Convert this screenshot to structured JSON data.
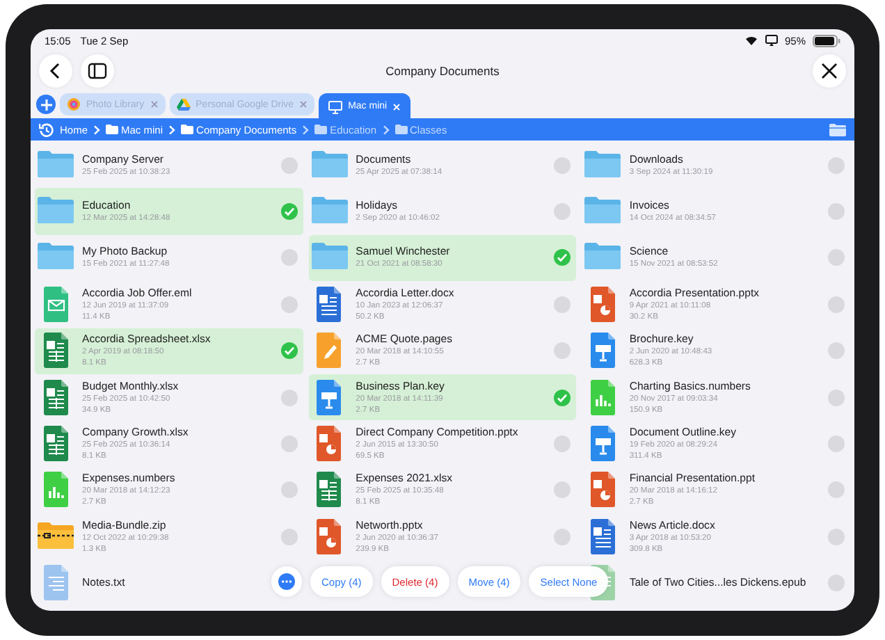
{
  "status_bar": {
    "time": "15:05",
    "date": "Tue 2 Sep",
    "battery": "95%"
  },
  "title": "Company Documents",
  "tabs": [
    {
      "label": "Photo Library",
      "kind": "photos",
      "selected": false
    },
    {
      "label": "Personal Google Drive",
      "kind": "drive",
      "selected": false
    },
    {
      "label": "Mac mini",
      "kind": "computer",
      "selected": true
    }
  ],
  "breadcrumb": [
    {
      "label": "Home",
      "folder": false,
      "disabled": false
    },
    {
      "label": "Mac mini",
      "folder": true,
      "disabled": false
    },
    {
      "label": "Company Documents",
      "folder": true,
      "disabled": false
    },
    {
      "label": "Education",
      "folder": true,
      "disabled": true
    },
    {
      "label": "Classes",
      "folder": true,
      "disabled": true
    }
  ],
  "files": [
    {
      "name": "Company Server",
      "date": "25 Feb 2025 at 10:38:23",
      "kind": "folder",
      "selected": false
    },
    {
      "name": "Documents",
      "date": "25 Apr 2025 at 07:38:14",
      "kind": "folder",
      "selected": false
    },
    {
      "name": "Downloads",
      "date": "3 Sep 2024 at 11:30:19",
      "kind": "folder",
      "selected": false
    },
    {
      "name": "Education",
      "date": "12 Mar 2025 at 14:28:48",
      "kind": "folder",
      "selected": true
    },
    {
      "name": "Holidays",
      "date": "2 Sep 2020 at 10:46:02",
      "kind": "folder",
      "selected": false
    },
    {
      "name": "Invoices",
      "date": "14 Oct 2024 at 08:34:57",
      "kind": "folder",
      "selected": false
    },
    {
      "name": "My Photo Backup",
      "date": "15 Feb 2021 at 11:27:48",
      "kind": "folder",
      "selected": false
    },
    {
      "name": "Samuel Winchester",
      "date": "21 Oct 2021 at 08:58:30",
      "kind": "folder",
      "selected": true
    },
    {
      "name": "Science",
      "date": "15 Nov 2021 at 08:53:52",
      "kind": "folder",
      "selected": false
    },
    {
      "name": "Accordia Job Offer.eml",
      "date": "12 Jun 2019 at 11:37:09",
      "size": "11.4 KB",
      "kind": "mail",
      "selected": false
    },
    {
      "name": "Accordia Letter.docx",
      "date": "10 Jan 2023 at 12:06:37",
      "size": "50.2 KB",
      "kind": "word",
      "selected": false
    },
    {
      "name": "Accordia Presentation.pptx",
      "date": "9 Apr 2021 at 10:11:08",
      "size": "30.2 KB",
      "kind": "powerpoint",
      "selected": false
    },
    {
      "name": "Accordia Spreadsheet.xlsx",
      "date": "2 Apr 2019 at 08:18:50",
      "size": "8.1 KB",
      "kind": "excel",
      "selected": true
    },
    {
      "name": "ACME Quote.pages",
      "date": "20 Mar 2018 at 14:10:55",
      "size": "2.7 KB",
      "kind": "pages",
      "selected": false
    },
    {
      "name": "Brochure.key",
      "date": "2 Jun 2020 at 10:48:43",
      "size": "628.3 KB",
      "kind": "keynote",
      "selected": false
    },
    {
      "name": "Budget Monthly.xlsx",
      "date": "25 Feb 2025 at 10:42:50",
      "size": "34.9 KB",
      "kind": "excel",
      "selected": false
    },
    {
      "name": "Business Plan.key",
      "date": "20 Mar 2018 at 14:11:39",
      "size": "2.7 KB",
      "kind": "keynote",
      "selected": true
    },
    {
      "name": "Charting Basics.numbers",
      "date": "20 Nov 2017 at 09:03:34",
      "size": "150.9 KB",
      "kind": "numbers",
      "selected": false
    },
    {
      "name": "Company Growth.xlsx",
      "date": "25 Feb 2025 at 10:36:14",
      "size": "8.1 KB",
      "kind": "excel",
      "selected": false
    },
    {
      "name": "Direct Company Competition.pptx",
      "date": "2 Jun 2015 at 13:30:50",
      "size": "69.5 KB",
      "kind": "powerpoint",
      "selected": false
    },
    {
      "name": "Document Outline.key",
      "date": "19 Feb 2020 at 08:29:24",
      "size": "311.4 KB",
      "kind": "keynote",
      "selected": false
    },
    {
      "name": "Expenses.numbers",
      "date": "20 Mar 2018 at 14:12:23",
      "size": "2.7 KB",
      "kind": "numbers",
      "selected": false
    },
    {
      "name": "Expenses 2021.xlsx",
      "date": "25 Feb 2025 at 10:35:48",
      "size": "8.1 KB",
      "kind": "excel",
      "selected": false
    },
    {
      "name": "Financial Presentation.ppt",
      "date": "20 Mar 2018 at 14:16:12",
      "size": "2.7 KB",
      "kind": "powerpoint",
      "selected": false
    },
    {
      "name": "Media-Bundle.zip",
      "date": "12 Oct 2022 at 10:29:38",
      "size": "1.3 KB",
      "kind": "zip",
      "selected": false
    },
    {
      "name": "Networth.pptx",
      "date": "2 Jun 2020 at 10:36:37",
      "size": "239.9 KB",
      "kind": "powerpoint",
      "selected": false
    },
    {
      "name": "News Article.docx",
      "date": "3 Apr 2018 at 10:53:20",
      "size": "309.8 KB",
      "kind": "word",
      "selected": false
    },
    {
      "name": "Notes.txt",
      "kind": "text"
    },
    {
      "kind": "hidden"
    },
    {
      "name": "Tale of Two Cities...les Dickens.epub",
      "kind": "book",
      "selected": false
    }
  ],
  "actions": [
    {
      "label": "Copy (4)",
      "kind": "normal"
    },
    {
      "label": "Delete (4)",
      "kind": "destructive"
    },
    {
      "label": "Move (4)",
      "kind": "normal"
    },
    {
      "label": "Select None",
      "kind": "normal"
    }
  ]
}
